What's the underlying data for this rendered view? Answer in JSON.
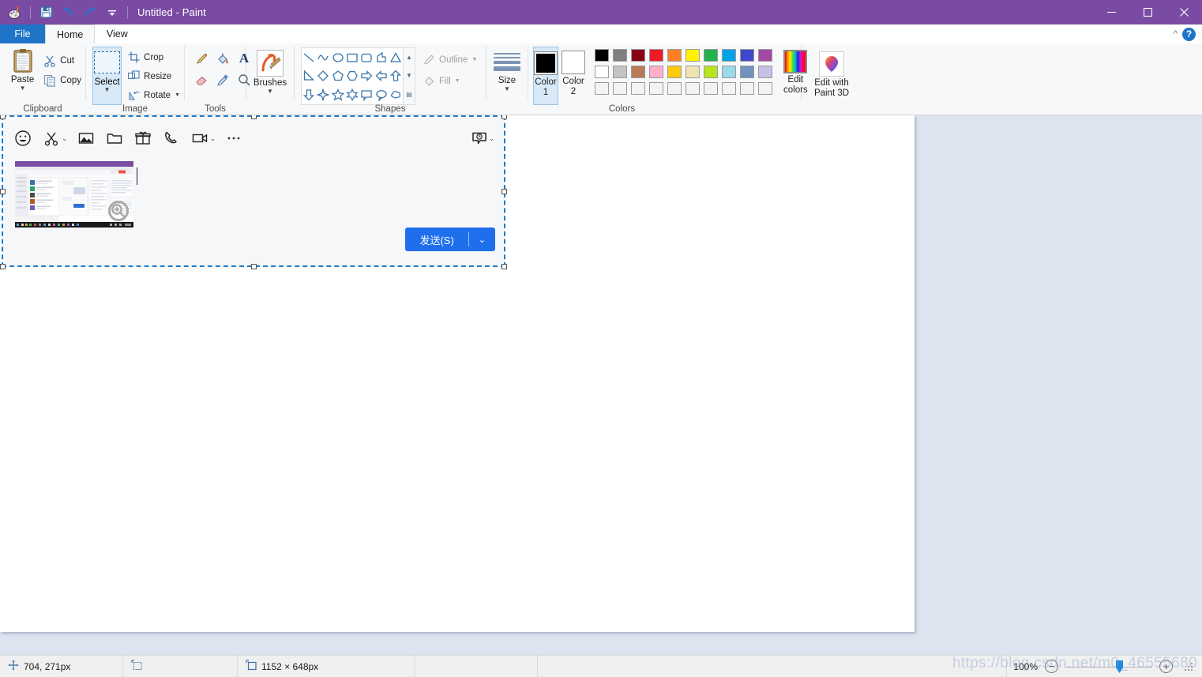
{
  "window": {
    "title": "Untitled - Paint",
    "quick_access": [
      "paint-logo-icon",
      "save-icon",
      "undo-icon",
      "redo-icon",
      "customize-qat-icon"
    ],
    "controls": {
      "minimize": "—",
      "maximize": "☐",
      "close": "✕"
    },
    "titlebar_color": "#7a4ba3"
  },
  "tabs": [
    {
      "label": "File",
      "id": "file",
      "state": "accent"
    },
    {
      "label": "Home",
      "id": "home",
      "state": "active"
    },
    {
      "label": "View",
      "id": "view",
      "state": "normal"
    }
  ],
  "ribbon_right": {
    "collapse": "^",
    "help": "?"
  },
  "ribbon": {
    "clipboard": {
      "label": "Clipboard",
      "paste": {
        "label": "Paste",
        "icon": "clipboard-icon"
      },
      "cut": {
        "label": "Cut",
        "icon": "scissors-icon"
      },
      "copy": {
        "label": "Copy",
        "icon": "copy-icon"
      }
    },
    "image": {
      "label": "Image",
      "select": {
        "label": "Select",
        "icon": "selection-rectangle-icon"
      },
      "crop": {
        "label": "Crop",
        "icon": "crop-icon"
      },
      "resize": {
        "label": "Resize",
        "icon": "resize-icon"
      },
      "rotate": {
        "label": "Rotate",
        "icon": "rotate-icon"
      }
    },
    "tools": {
      "label": "Tools",
      "items": [
        "pencil-icon",
        "fill-bucket-icon",
        "text-icon",
        "eraser-icon",
        "color-picker-icon",
        "magnifier-icon"
      ]
    },
    "brushes": {
      "label": "Brushes",
      "icon": "brush-icon"
    },
    "shapes": {
      "label": "Shapes",
      "items": [
        "line-shape",
        "curve-shape",
        "oval-shape",
        "rectangle-shape",
        "rounded-rectangle-shape",
        "polygon-shape",
        "triangle-shape",
        "right-triangle-shape",
        "diamond-shape",
        "pentagon-shape",
        "hexagon-shape",
        "right-arrow-shape",
        "left-arrow-shape",
        "up-arrow-shape",
        "down-arrow-shape",
        "four-point-star-shape",
        "five-point-star-shape",
        "six-point-star-shape",
        "rounded-callout-shape",
        "oval-callout-shape",
        "cloud-callout-shape"
      ],
      "outline": {
        "label": "Outline",
        "icon": "outline-icon",
        "enabled": false
      },
      "fill": {
        "label": "Fill",
        "icon": "fill-icon",
        "enabled": false
      }
    },
    "size": {
      "label": "Size",
      "icon": "size-lines-icon"
    },
    "colors": {
      "label": "Colors",
      "color1": {
        "label": "Color\n1",
        "value": "#000000",
        "selected": true
      },
      "color2": {
        "label": "Color\n2",
        "value": "#ffffff",
        "selected": false
      },
      "color1_line1": "Color",
      "color1_line2": "1",
      "color2_line1": "Color",
      "color2_line2": "2",
      "palette_row1": [
        "#000000",
        "#7f7f7f",
        "#880015",
        "#ed1c24",
        "#ff7f27",
        "#fff200",
        "#22b14c",
        "#00a2e8",
        "#3f48cc",
        "#a349a4"
      ],
      "palette_row2": [
        "#ffffff",
        "#c3c3c3",
        "#b97a57",
        "#ffaec9",
        "#ffc90e",
        "#efe4b0",
        "#b5e61d",
        "#99d9ea",
        "#7092be",
        "#c8bfe7"
      ],
      "palette_row3": [
        "#f2f3f5",
        "#f2f3f5",
        "#f2f3f5",
        "#f2f3f5",
        "#f2f3f5",
        "#f2f3f5",
        "#f2f3f5",
        "#f2f3f5",
        "#f2f3f5",
        "#f2f3f5"
      ],
      "edit_colors": {
        "line1": "Edit",
        "line2": "colors",
        "icon": "color-wheel-icon"
      }
    },
    "paint3d": {
      "line1": "Edit with",
      "line2": "Paint 3D",
      "icon": "paint3d-icon"
    }
  },
  "canvas": {
    "pasted_selection": {
      "toolbar_icons": [
        "emoji-icon",
        "screenshot-scissors-icon",
        "image-icon",
        "folder-icon",
        "gift-icon",
        "phone-icon",
        "video-call-icon",
        "more-options-icon"
      ],
      "history_icon": "chat-history-icon",
      "thumbnail": {
        "name": "pasted-screenshot-thumbnail",
        "zoom_badge": "zoom-in-icon"
      },
      "send_button": {
        "label": "发送(S)",
        "caret": "⌄",
        "color": "#1f6fed"
      }
    }
  },
  "statusbar": {
    "cursor_position": "704, 271px",
    "selection_icon": "selection-size-icon",
    "cursor_icon": "crosshair-icon",
    "image_size_icon": "image-size-icon",
    "image_size": "1152 × 648px",
    "zoom_level": "100%",
    "zoom_out": "−",
    "zoom_in": "+"
  },
  "watermark": "https://blog.csdn.net/m0_46555680"
}
